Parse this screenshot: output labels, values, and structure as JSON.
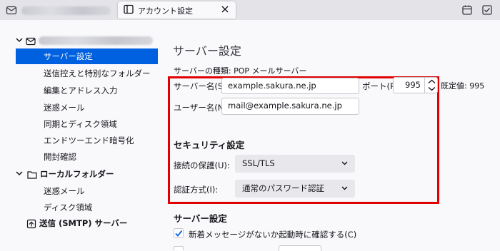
{
  "tabs": {
    "active_title": "アカウント設定"
  },
  "sidebar": {
    "account": "",
    "items": [
      "サーバー設定",
      "送信控えと特別なフォルダー",
      "編集とアドレス入力",
      "迷惑メール",
      "同期とディスク領域",
      "エンドツーエンド暗号化",
      "開封確認"
    ],
    "local_folder": "ローカルフォルダー",
    "local_items": [
      "迷惑メール",
      "ディスク領域"
    ],
    "smtp": "送信 (SMTP) サーバー"
  },
  "main": {
    "title": "サーバー設定",
    "server_type_label": "サーバーの種類:",
    "server_type_value": "POP メールサーバー",
    "server_name_label": "サーバー名(S):",
    "server_name_value": "example.sakura.ne.jp",
    "port_label": "ポート(P):",
    "port_value": "995",
    "default_label": "既定値:",
    "default_value": "995",
    "username_label": "ユーザー名(N):",
    "username_value": "mail@example.sakura.ne.jp",
    "security_heading": "セキュリティ設定",
    "connection_label": "接続の保護(U):",
    "connection_value": "SSL/TLS",
    "auth_label": "認証方式(I):",
    "auth_value": "通常のパスワード認証",
    "server_settings_heading": "サーバー設定",
    "check_label": "新着メッセージがないか起動時に確認する(C)",
    "check_checked": true
  },
  "colors": {
    "accent": "#0061e0",
    "highlight": "#e00000"
  }
}
